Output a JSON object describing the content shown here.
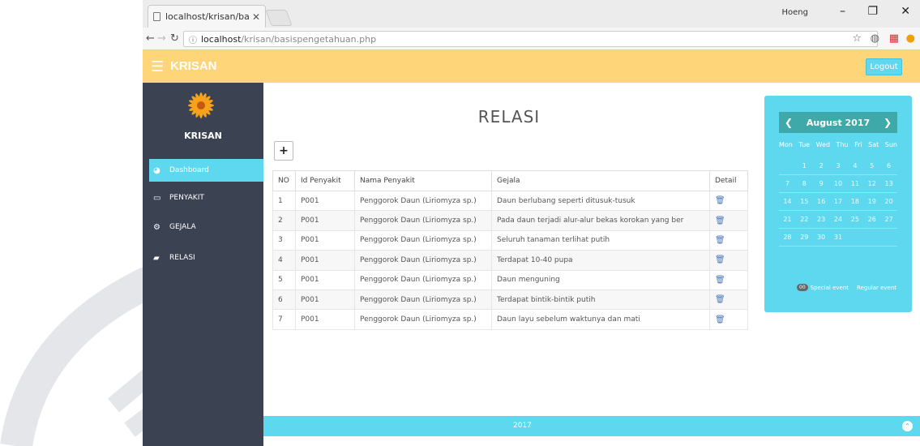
{
  "browser": {
    "tab_title": "localhost/krisan/basispe",
    "url_host": "localhost",
    "url_path": "/krisan/basispengetahuan.php",
    "window_user": "Hoeng"
  },
  "header": {
    "brand": "KRISAN",
    "logout_label": "Logout"
  },
  "sidebar": {
    "name": "KRISAN",
    "items": [
      {
        "label": "Dashboard",
        "icon": "dashboard-icon"
      },
      {
        "label": "PENYAKIT",
        "icon": "monitor-icon"
      },
      {
        "label": "GEJALA",
        "icon": "gears-icon"
      },
      {
        "label": "RELASI",
        "icon": "book-icon"
      }
    ]
  },
  "main": {
    "title": "RELASI",
    "add_label": "+",
    "columns": [
      "NO",
      "Id Penyakit",
      "Nama Penyakit",
      "Gejala",
      "Detail"
    ],
    "rows": [
      [
        "1",
        "P001",
        "Penggorok Daun (Liriomyza sp.)",
        "Daun berlubang seperti ditusuk-tusuk"
      ],
      [
        "2",
        "P001",
        "Penggorok Daun (Liriomyza sp.)",
        "Pada daun terjadi alur-alur bekas korokan yang ber"
      ],
      [
        "3",
        "P001",
        "Penggorok Daun (Liriomyza sp.)",
        "Seluruh tanaman terlihat putih"
      ],
      [
        "4",
        "P001",
        "Penggorok Daun (Liriomyza sp.)",
        "Terdapat 10-40 pupa"
      ],
      [
        "5",
        "P001",
        "Penggorok Daun (Liriomyza sp.)",
        "Daun menguning"
      ],
      [
        "6",
        "P001",
        "Penggorok Daun (Liriomyza sp.)",
        "Terdapat bintik-bintik putih"
      ],
      [
        "7",
        "P001",
        "Penggorok Daun (Liriomyza sp.)",
        "Daun layu sebelum waktunya dan mati"
      ]
    ]
  },
  "footer": {
    "year": "2017"
  },
  "calendar": {
    "month": "August 2017",
    "dows": [
      "Mon",
      "Tue",
      "Wed",
      "Thu",
      "Fri",
      "Sat",
      "Sun"
    ],
    "weeks": [
      [
        "",
        "1",
        "2",
        "3",
        "4",
        "5",
        "6"
      ],
      [
        "7",
        "8",
        "9",
        "10",
        "11",
        "12",
        "13"
      ],
      [
        "14",
        "15",
        "16",
        "17",
        "18",
        "19",
        "20"
      ],
      [
        "21",
        "22",
        "23",
        "24",
        "25",
        "26",
        "27"
      ],
      [
        "28",
        "29",
        "30",
        "31",
        "",
        "",
        ""
      ]
    ],
    "legend_pill": "00",
    "legend_special": "Special event",
    "legend_regular": "Regular event"
  },
  "colors": {
    "header": "#ffd57a",
    "sidebar": "#3b4252",
    "accent": "#5ed8ef",
    "calendar_header": "#3fa8a8"
  }
}
